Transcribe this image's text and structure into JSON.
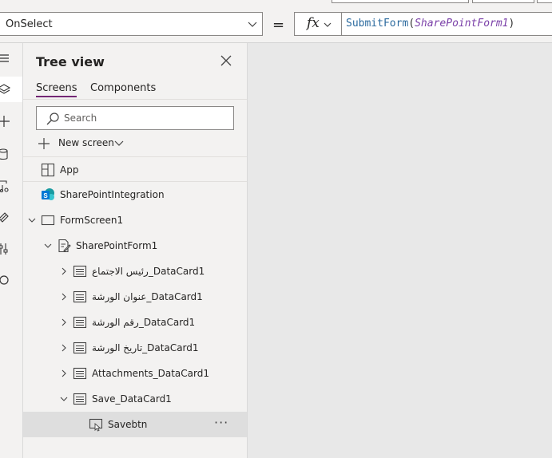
{
  "formula_bar": {
    "property": "OnSelect",
    "equals": "=",
    "fx_label": "fx",
    "formula_fn": "SubmitForm",
    "formula_open": "(",
    "formula_arg": "SharePointForm1",
    "formula_close": ")"
  },
  "rail": {
    "icons": [
      "hamburger-icon",
      "layers-icon",
      "plus-icon",
      "database-icon",
      "media-icon",
      "controls-icon",
      "tools-icon",
      "search-icon"
    ],
    "active_index": 1
  },
  "tree_view": {
    "title": "Tree view",
    "tabs": [
      {
        "label": "Screens",
        "active": true
      },
      {
        "label": "Components",
        "active": false
      }
    ],
    "search_placeholder": "Search",
    "new_screen_label": "New screen",
    "nodes": [
      {
        "label": "App",
        "icon": "app-icon",
        "expanded": null
      },
      {
        "label": "SharePointIntegration",
        "icon": "sharepoint-icon",
        "expanded": null
      },
      {
        "label": "FormScreen1",
        "icon": "screen-icon",
        "expanded": true
      },
      {
        "label": "SharePointForm1",
        "icon": "form-icon",
        "expanded": true
      },
      {
        "label": "رئيس الاجتماع_DataCard1",
        "icon": "card-icon",
        "expanded": false
      },
      {
        "label": "عنوان الورشة_DataCard1",
        "icon": "card-icon",
        "expanded": false
      },
      {
        "label": "رقم الورشة_DataCard1",
        "icon": "card-icon",
        "expanded": false
      },
      {
        "label": "تاريخ الورشة_DataCard1",
        "icon": "card-icon",
        "expanded": false
      },
      {
        "label": "Attachments_DataCard1",
        "icon": "card-icon",
        "expanded": false
      },
      {
        "label": "Save_DataCard1",
        "icon": "card-icon",
        "expanded": true
      },
      {
        "label": "Savebtn",
        "icon": "button-icon",
        "expanded": null,
        "selected": true
      }
    ],
    "more_label": "···",
    "selected_color": "#dedede"
  },
  "colors": {
    "accent": "#742774",
    "formula_fn": "#2b6a9e",
    "formula_arg": "#7a3fa8",
    "canvas": "#e8e8e8"
  }
}
